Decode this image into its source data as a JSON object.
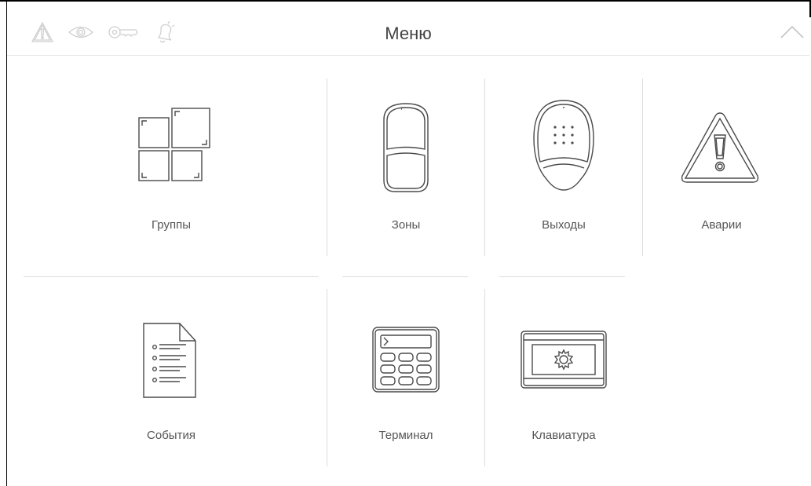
{
  "header": {
    "title": "Меню",
    "status_icons": [
      "alarm-icon",
      "view-icon",
      "key-icon",
      "bell-icon"
    ],
    "collapse_icon": "chevron-up-icon"
  },
  "menu": {
    "items": [
      {
        "label": "Группы",
        "icon": "partitions-icon"
      },
      {
        "label": "Зоны",
        "icon": "zones-icon"
      },
      {
        "label": "Выходы",
        "icon": "outputs-icon"
      },
      {
        "label": "Аварии",
        "icon": "troubles-icon"
      },
      {
        "label": "События",
        "icon": "events-icon"
      },
      {
        "label": "Терминал",
        "icon": "terminal-icon"
      },
      {
        "label": "Клавиатура",
        "icon": "keypad-icon"
      }
    ]
  },
  "colors": {
    "icon_stroke": "#4a4a4a",
    "status_icon": "#cfcfcf",
    "separator": "#dddddd",
    "text": "#555555"
  }
}
